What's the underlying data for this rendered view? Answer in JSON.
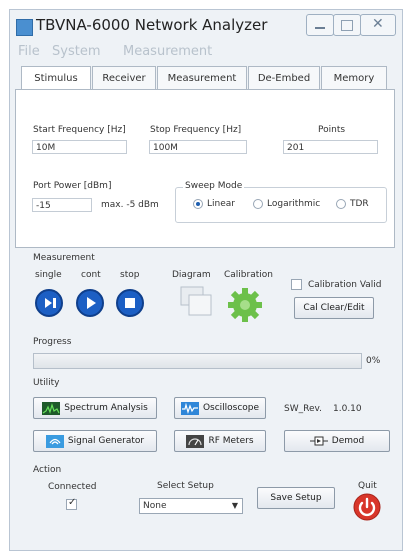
{
  "window": {
    "title": "TBVNA-6000 Network Analyzer"
  },
  "menu": {
    "items": [
      {
        "label": "File"
      },
      {
        "label": "System"
      },
      {
        "label": "Measurement"
      }
    ]
  },
  "tabs": [
    {
      "label": "Stimulus",
      "active": true
    },
    {
      "label": "Receiver",
      "active": false
    },
    {
      "label": "Measurement",
      "active": false
    },
    {
      "label": "De-Embed",
      "active": false
    },
    {
      "label": "Memory",
      "active": false
    }
  ],
  "stimulus": {
    "start_label": "Start Frequency [Hz]",
    "start_value": "10M",
    "stop_label": "Stop Frequency [Hz]",
    "stop_value": "100M",
    "points_label": "Points",
    "points_value": "201",
    "power_label": "Port  Power [dBm]",
    "power_value": "-15",
    "power_max": "max. -5 dBm",
    "sweep_mode_label": "Sweep Mode",
    "sweep_options": [
      {
        "label": "Linear",
        "selected": true
      },
      {
        "label": "Logarithmic",
        "selected": false
      },
      {
        "label": "TDR",
        "selected": false
      }
    ]
  },
  "measurement": {
    "section_label": "Measurement",
    "single_label": "single",
    "cont_label": "cont",
    "stop_label": "stop",
    "diagram_label": "Diagram",
    "calibration_label": "Calibration",
    "calibration_valid_label": "Calibration Valid",
    "calibration_valid": false,
    "cal_clear_label": "Cal Clear/Edit"
  },
  "progress": {
    "label": "Progress",
    "value": 0,
    "text": "0%"
  },
  "utility": {
    "label": "Utility",
    "spectrum_label": "Spectrum Analysis",
    "oscilloscope_label": "Oscilloscope",
    "sw_rev_label": "SW_Rev.",
    "sw_rev_value": "1.0.10",
    "signal_gen_label": "Signal Generator",
    "rf_meters_label": "RF Meters",
    "demod_label": "Demod"
  },
  "action": {
    "label": "Action",
    "connected_label": "Connected",
    "connected": true,
    "select_setup_label": "Select Setup",
    "select_setup_value": "None",
    "save_setup_label": "Save Setup",
    "quit_label": "Quit"
  },
  "colors": {
    "accent": "#1c5fc4",
    "quit_red": "#d8362a",
    "calibration_green": "#6cc04a"
  }
}
